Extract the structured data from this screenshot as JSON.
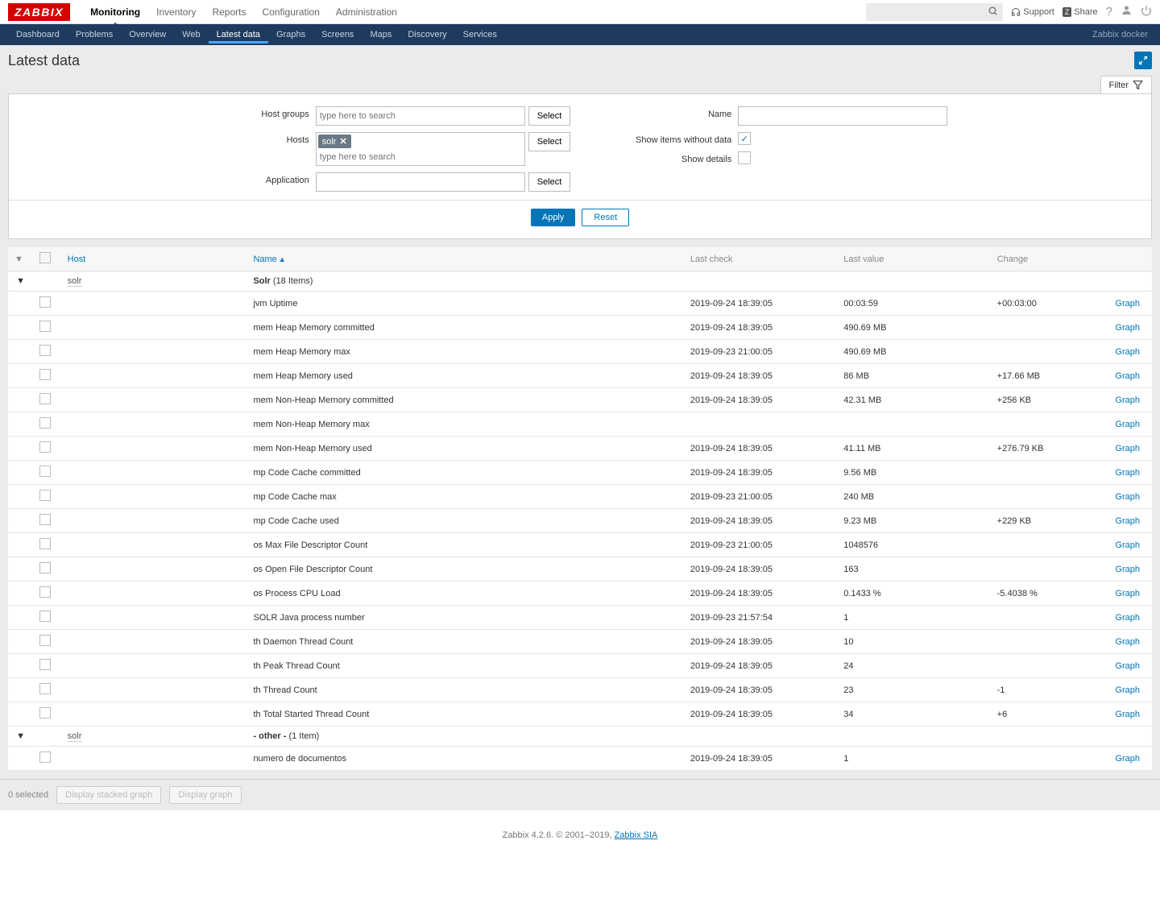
{
  "logo": "ZABBIX",
  "topnav": [
    "Monitoring",
    "Inventory",
    "Reports",
    "Configuration",
    "Administration"
  ],
  "topnav_active": 0,
  "support": "Support",
  "share": "Share",
  "subnav": [
    "Dashboard",
    "Problems",
    "Overview",
    "Web",
    "Latest data",
    "Graphs",
    "Screens",
    "Maps",
    "Discovery",
    "Services"
  ],
  "subnav_active": 4,
  "subnav_right": "Zabbix docker",
  "page_title": "Latest data",
  "filter_tab": "Filter",
  "filter": {
    "host_groups_label": "Host groups",
    "host_groups_placeholder": "type here to search",
    "hosts_label": "Hosts",
    "hosts_token": "solr",
    "hosts_placeholder": "type here to search",
    "application_label": "Application",
    "name_label": "Name",
    "show_items_label": "Show items without data",
    "show_items_checked": true,
    "show_details_label": "Show details",
    "show_details_checked": false,
    "select_btn": "Select",
    "apply": "Apply",
    "reset": "Reset"
  },
  "columns": {
    "host": "Host",
    "name": "Name",
    "last_check": "Last check",
    "last_value": "Last value",
    "change": "Change"
  },
  "groups": [
    {
      "host": "solr",
      "app": "Solr",
      "count": "(18 Items)",
      "items": [
        {
          "name": "jvm Uptime",
          "check": "2019-09-24 18:39:05",
          "value": "00:03:59",
          "change": "+00:03:00",
          "graph": "Graph"
        },
        {
          "name": "mem Heap Memory committed",
          "check": "2019-09-24 18:39:05",
          "value": "490.69 MB",
          "change": "",
          "graph": "Graph"
        },
        {
          "name": "mem Heap Memory max",
          "check": "2019-09-23 21:00:05",
          "value": "490.69 MB",
          "change": "",
          "graph": "Graph"
        },
        {
          "name": "mem Heap Memory used",
          "check": "2019-09-24 18:39:05",
          "value": "86 MB",
          "change": "+17.66 MB",
          "graph": "Graph"
        },
        {
          "name": "mem Non-Heap Memory committed",
          "check": "2019-09-24 18:39:05",
          "value": "42.31 MB",
          "change": "+256 KB",
          "graph": "Graph"
        },
        {
          "name": "mem Non-Heap Memory max",
          "check": "",
          "value": "",
          "change": "",
          "graph": "Graph",
          "disabled": true
        },
        {
          "name": "mem Non-Heap Memory used",
          "check": "2019-09-24 18:39:05",
          "value": "41.11 MB",
          "change": "+276.79 KB",
          "graph": "Graph"
        },
        {
          "name": "mp Code Cache committed",
          "check": "2019-09-24 18:39:05",
          "value": "9.56 MB",
          "change": "",
          "graph": "Graph"
        },
        {
          "name": "mp Code Cache max",
          "check": "2019-09-23 21:00:05",
          "value": "240 MB",
          "change": "",
          "graph": "Graph"
        },
        {
          "name": "mp Code Cache used",
          "check": "2019-09-24 18:39:05",
          "value": "9.23 MB",
          "change": "+229 KB",
          "graph": "Graph"
        },
        {
          "name": "os Max File Descriptor Count",
          "check": "2019-09-23 21:00:05",
          "value": "1048576",
          "change": "",
          "graph": "Graph"
        },
        {
          "name": "os Open File Descriptor Count",
          "check": "2019-09-24 18:39:05",
          "value": "163",
          "change": "",
          "graph": "Graph"
        },
        {
          "name": "os Process CPU Load",
          "check": "2019-09-24 18:39:05",
          "value": "0.1433 %",
          "change": "-5.4038 %",
          "graph": "Graph"
        },
        {
          "name": "SOLR Java process number",
          "check": "2019-09-23 21:57:54",
          "value": "1",
          "change": "",
          "graph": "Graph"
        },
        {
          "name": "th Daemon Thread Count",
          "check": "2019-09-24 18:39:05",
          "value": "10",
          "change": "",
          "graph": "Graph"
        },
        {
          "name": "th Peak Thread Count",
          "check": "2019-09-24 18:39:05",
          "value": "24",
          "change": "",
          "graph": "Graph"
        },
        {
          "name": "th Thread Count",
          "check": "2019-09-24 18:39:05",
          "value": "23",
          "change": "-1",
          "graph": "Graph"
        },
        {
          "name": "th Total Started Thread Count",
          "check": "2019-09-24 18:39:05",
          "value": "34",
          "change": "+6",
          "graph": "Graph"
        }
      ]
    },
    {
      "host": "solr",
      "app": "- other -",
      "count": "(1 Item)",
      "items": [
        {
          "name": "numero de documentos",
          "check": "2019-09-24 18:39:05",
          "value": "1",
          "change": "",
          "graph": "Graph"
        }
      ]
    }
  ],
  "selected_text": "0 selected",
  "btn_stacked": "Display stacked graph",
  "btn_graph": "Display graph",
  "footer": {
    "text": "Zabbix 4.2.6. © 2001–2019, ",
    "link": "Zabbix SIA"
  }
}
